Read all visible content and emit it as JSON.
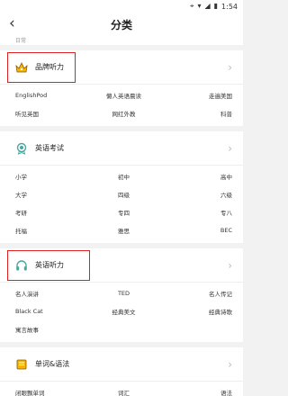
{
  "status": {
    "time": "1:54"
  },
  "header": {
    "back": "‹",
    "title": "分类"
  },
  "top_cut_text": "日常",
  "sections": [
    {
      "title": "品牌听力",
      "icon": "crown-icon",
      "rows": [
        [
          "EnglishPod",
          "懒人英语晨读",
          "走遍美国"
        ],
        [
          "听见英国",
          "网红外教",
          "科普"
        ]
      ]
    },
    {
      "title": "英语考试",
      "icon": "award-medal-icon",
      "rows": [
        [
          "小学",
          "初中",
          "高中"
        ],
        [
          "大学",
          "四级",
          "六级"
        ],
        [
          "考研",
          "专四",
          "专八"
        ],
        [
          "托福",
          "雅思",
          "BEC"
        ]
      ]
    },
    {
      "title": "英语听力",
      "icon": "headphones-icon",
      "rows": [
        [
          "名人演讲",
          "TED",
          "名人传记"
        ],
        [
          "Black Cat",
          "经典美文",
          "经典诗歌"
        ],
        [
          "寓言故事",
          "",
          ""
        ]
      ]
    },
    {
      "title": "单词&语法",
      "icon": "book-icon",
      "rows": [
        [
          "闭眼飘单词",
          "词汇",
          "语法"
        ]
      ]
    }
  ],
  "colors": {
    "accent": "#f5b400",
    "highlight": "#e02020",
    "teal": "#4aa8a0"
  }
}
